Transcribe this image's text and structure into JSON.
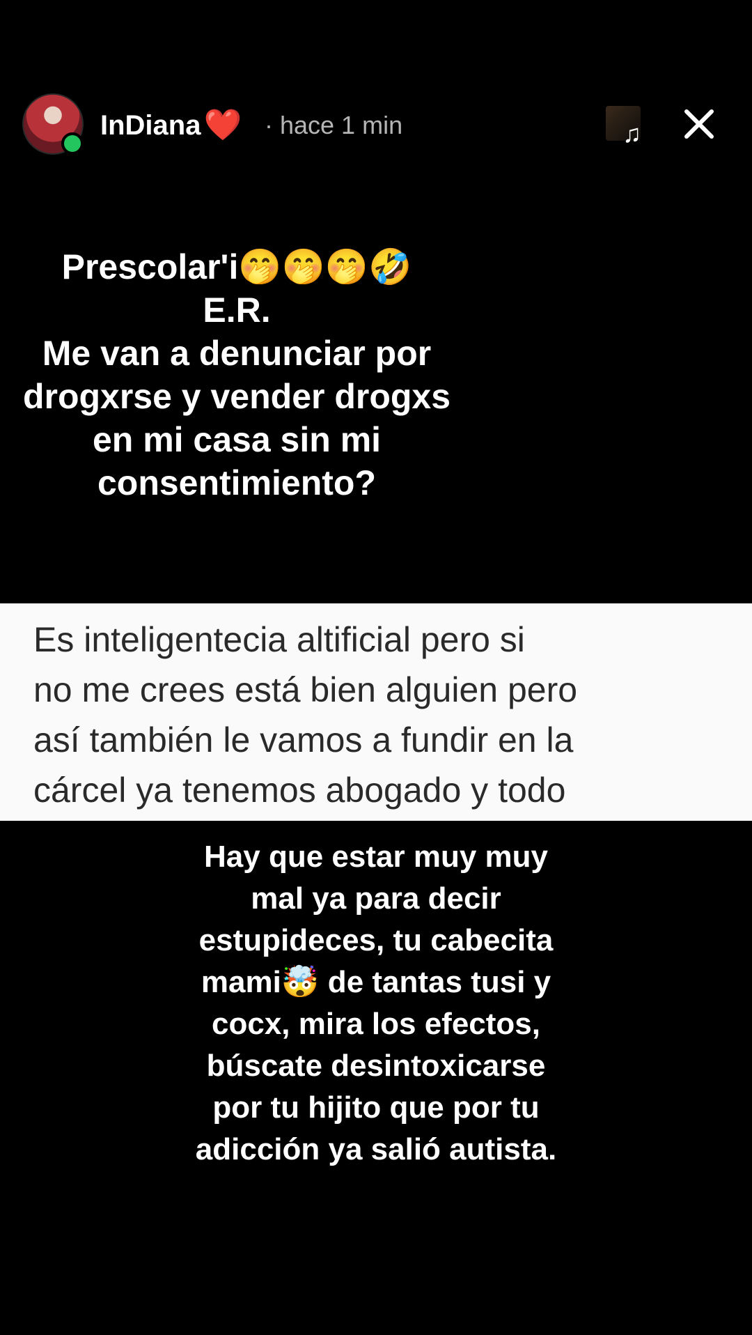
{
  "header": {
    "username": "InDiana",
    "username_badge": "❤️",
    "timestamp": "· hace 1 min",
    "music_icon": "♫",
    "close_label": "✕"
  },
  "story": {
    "top_lines": [
      "Prescolar'i🤭🤭🤭🤣",
      "E.R.",
      "Me van a denunciar por",
      "drogxrse y vender drogxs",
      "en mi casa sin mi",
      "consentimiento?"
    ],
    "quote_lines": [
      "Es inteligentecia altificial pero si",
      "no me crees está bien alguien pero",
      "así también le vamos a fundir en la",
      "cárcel ya tenemos abogado y todo"
    ],
    "bottom_lines": [
      "Hay que estar muy muy",
      "mal ya para decir",
      "estupideces, tu cabecita",
      "mami🤯 de tantas tusi y",
      "cocx, mira los efectos,",
      "búscate desintoxicarse",
      "por tu hijito que por tu",
      "adicción ya salió autista."
    ]
  },
  "colors": {
    "background": "#000000",
    "online": "#22c55e",
    "quote_panel": "#fafafa",
    "quote_text": "#2a2a2a",
    "timestamp": "#b5b5b5"
  }
}
